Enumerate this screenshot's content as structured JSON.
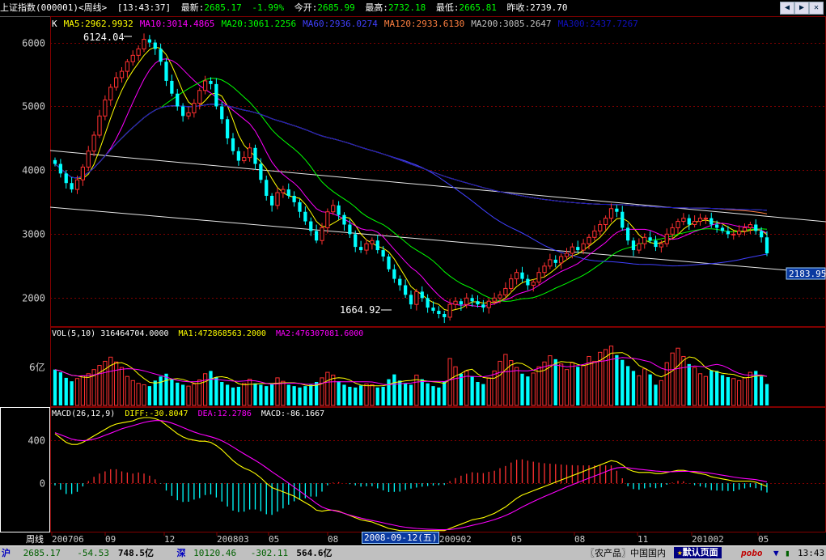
{
  "header": {
    "title": "上证指数(000001)<周线>",
    "time": "[13:43:37]",
    "latest_label": "最新:",
    "latest_value": "2685.17",
    "change_pct": "-1.99%",
    "open_label": "今开:",
    "open_value": "2685.99",
    "high_label": "最高:",
    "high_value": "2732.18",
    "low_label": "最低:",
    "low_value": "2665.81",
    "prev_label": "昨收:",
    "prev_value": "2739.70"
  },
  "ma_legend": {
    "k": "K",
    "items": [
      {
        "text": "MA5:2962.9932",
        "color": "#ffff00"
      },
      {
        "text": "MA10:3014.4865",
        "color": "#ff00ff"
      },
      {
        "text": "MA20:3061.2256",
        "color": "#00ff00"
      },
      {
        "text": "MA60:2936.0274",
        "color": "#4040ff"
      },
      {
        "text": "MA120:2933.6130",
        "color": "#ff8040"
      },
      {
        "text": "MA200:3085.2647",
        "color": "#c0c0c0"
      },
      {
        "text": "MA300:2437.7267",
        "color": "#1010c0"
      }
    ]
  },
  "vol_legend": {
    "label": "VOL(5,10) 316464704.0000",
    "ma1": "MA1:472868563.2000",
    "ma2": "MA2:476307081.6000"
  },
  "macd_legend": {
    "label": "MACD(26,12,9)",
    "diff": "DIFF:-30.8047",
    "dea": "DEA:12.2786",
    "macd": "MACD:-86.1667"
  },
  "annotations": {
    "high_label": "6124.04",
    "low_label": "1664.92",
    "trendline_value": "2183.95",
    "vol_axis": "6亿",
    "x_axis_title": "周线",
    "selected_date": "2008-09-12(五)"
  },
  "chart_data": {
    "type": "candlestick",
    "price_axis": {
      "ticks": [
        2000,
        3000,
        4000,
        5000,
        6000
      ],
      "ylim": [
        1560,
        6400
      ]
    },
    "macd_axis": {
      "ticks": [
        400,
        0
      ],
      "ylim": [
        -450,
        700
      ]
    },
    "x_tick_labels": [
      "200706",
      "09",
      "12",
      "200803",
      "05",
      "08",
      "200902",
      "05",
      "08",
      "11",
      "201002",
      "05"
    ],
    "colors": {
      "up": "#ff3030",
      "down": "#00ffff",
      "ma5": "#ffff00",
      "ma10": "#ff00ff",
      "ma20": "#00ff00",
      "ma60": "#4040ff",
      "ma120": "#ff8040",
      "ma200": "#c0c0c0",
      "ma300": "#1010c0",
      "grid": "#800000"
    },
    "close": [
      4100,
      3950,
      3800,
      3700,
      3850,
      4050,
      4300,
      4550,
      4850,
      5100,
      5300,
      5450,
      5550,
      5700,
      5800,
      5900,
      6050,
      6000,
      5900,
      5700,
      5400,
      5200,
      5000,
      4850,
      4900,
      5050,
      5250,
      5400,
      5350,
      5000,
      4800,
      4500,
      4300,
      4150,
      4200,
      4350,
      4100,
      3850,
      3600,
      3450,
      3650,
      3700,
      3600,
      3500,
      3350,
      3200,
      3050,
      2900,
      3100,
      3350,
      3450,
      3300,
      3150,
      3000,
      2800,
      2750,
      2850,
      2900,
      2750,
      2650,
      2450,
      2300,
      2200,
      2050,
      1900,
      2100,
      2000,
      1850,
      1800,
      1750,
      1700,
      1900,
      1950,
      1900,
      2000,
      1950,
      1900,
      1850,
      1950,
      2000,
      2050,
      2150,
      2300,
      2400,
      2300,
      2200,
      2250,
      2400,
      2500,
      2600,
      2550,
      2650,
      2700,
      2800,
      2750,
      2850,
      2950,
      3050,
      3150,
      3250,
      3400,
      3350,
      3100,
      2900,
      2750,
      2850,
      2950,
      2900,
      2800,
      2850,
      3000,
      3100,
      3200,
      3250,
      3150,
      3200,
      3250,
      3250,
      3150,
      3100,
      3050,
      3000,
      3000,
      3050,
      3100,
      3150,
      3050,
      2950,
      2700
    ],
    "vol_axis": {
      "ylim": [
        0,
        9.5
      ]
    },
    "volume": [
      5.2,
      4.8,
      4.0,
      3.5,
      3.9,
      4.3,
      4.6,
      5.2,
      5.8,
      6.4,
      7.0,
      6.3,
      5.5,
      4.2,
      3.6,
      3.2,
      3.0,
      2.8,
      3.6,
      4.2,
      4.6,
      3.8,
      3.3,
      3.0,
      2.8,
      3.1,
      3.7,
      4.6,
      5.0,
      4.1,
      3.4,
      3.0,
      2.6,
      2.7,
      3.2,
      3.8,
      3.2,
      3.0,
      2.8,
      3.1,
      4.0,
      3.5,
      3.0,
      2.8,
      2.6,
      2.8,
      3.0,
      3.4,
      4.0,
      4.8,
      4.4,
      3.5,
      3.0,
      2.7,
      2.6,
      2.9,
      3.1,
      3.0,
      2.6,
      2.7,
      3.8,
      4.5,
      3.6,
      3.2,
      3.0,
      4.4,
      3.8,
      3.2,
      2.8,
      2.6,
      3.5,
      6.8,
      5.6,
      4.6,
      5.0,
      4.2,
      3.4,
      3.1,
      4.0,
      5.0,
      6.4,
      7.4,
      6.5,
      5.5,
      4.6,
      4.2,
      4.7,
      5.6,
      6.3,
      7.2,
      6.7,
      6.0,
      5.2,
      6.2,
      5.6,
      5.8,
      7.1,
      6.4,
      7.7,
      8.1,
      8.6,
      7.3,
      6.6,
      5.7,
      5.0,
      4.3,
      5.3,
      4.5,
      3.0,
      3.6,
      6.2,
      7.6,
      8.3,
      7.1,
      6.0,
      5.5,
      4.6,
      4.2,
      5.1,
      5.0,
      4.4,
      4.1,
      3.9,
      3.6,
      4.0,
      4.8,
      5.0,
      4.2,
      3.1
    ],
    "macd_diff": [
      460,
      420,
      380,
      360,
      360,
      380,
      410,
      440,
      470,
      500,
      530,
      550,
      560,
      570,
      580,
      600,
      610,
      610,
      600,
      580,
      540,
      500,
      460,
      430,
      410,
      400,
      390,
      390,
      380,
      350,
      310,
      260,
      210,
      170,
      140,
      120,
      90,
      50,
      0,
      -40,
      -60,
      -80,
      -100,
      -120,
      -150,
      -180,
      -210,
      -250,
      -260,
      -250,
      -250,
      -260,
      -280,
      -300,
      -320,
      -340,
      -350,
      -360,
      -380,
      -400,
      -420,
      -430,
      -440,
      -440,
      -440,
      -440,
      -440,
      -440,
      -440,
      -440,
      -440,
      -420,
      -400,
      -380,
      -360,
      -340,
      -330,
      -320,
      -300,
      -280,
      -250,
      -220,
      -180,
      -140,
      -110,
      -90,
      -70,
      -50,
      -30,
      -10,
      10,
      30,
      50,
      70,
      90,
      110,
      130,
      150,
      170,
      190,
      210,
      200,
      170,
      130,
      110,
      100,
      100,
      100,
      90,
      90,
      100,
      110,
      120,
      120,
      110,
      100,
      90,
      80,
      60,
      50,
      40,
      30,
      20,
      20,
      20,
      20,
      10,
      -10,
      -30
    ],
    "macd_dea": [
      470,
      450,
      430,
      410,
      400,
      395,
      400,
      410,
      425,
      445,
      465,
      485,
      505,
      520,
      535,
      550,
      565,
      575,
      582,
      582,
      574,
      559,
      539,
      517,
      496,
      476,
      459,
      445,
      432,
      416,
      395,
      368,
      337,
      304,
      272,
      242,
      212,
      180,
      144,
      107,
      72,
      37,
      0,
      -36,
      -73,
      -110,
      -148,
      -188,
      -221,
      -240,
      -253,
      -265,
      -280,
      -296,
      -310,
      -324,
      -336,
      -346,
      -356,
      -367,
      -379,
      -390,
      -401,
      -409,
      -415,
      -420,
      -424,
      -427,
      -429,
      -431,
      -432,
      -430,
      -424,
      -415,
      -404,
      -391,
      -379,
      -367,
      -353,
      -338,
      -320,
      -300,
      -276,
      -249,
      -221,
      -195,
      -170,
      -146,
      -123,
      -101,
      -79,
      -57,
      -35,
      -14,
      7,
      27,
      47,
      67,
      87,
      107,
      127,
      142,
      147,
      144,
      137,
      130,
      124,
      119,
      113,
      109,
      107,
      107,
      109,
      111,
      111,
      109,
      105,
      100,
      92,
      84,
      75,
      66,
      57,
      50,
      44,
      39,
      33,
      24,
      13
    ]
  },
  "bottom_bar": {
    "sh_label": "沪",
    "sh_index": "2685.17",
    "sh_change": "-54.53",
    "sh_amount": "748.5亿",
    "sz_label": "深",
    "sz_index": "10120.46",
    "sz_change": "-302.11",
    "sz_amount": "564.6亿",
    "ticker": "〖农产品〗中国国内",
    "default_page": "默认页面",
    "brand": "pobo",
    "clock": "13:43"
  }
}
